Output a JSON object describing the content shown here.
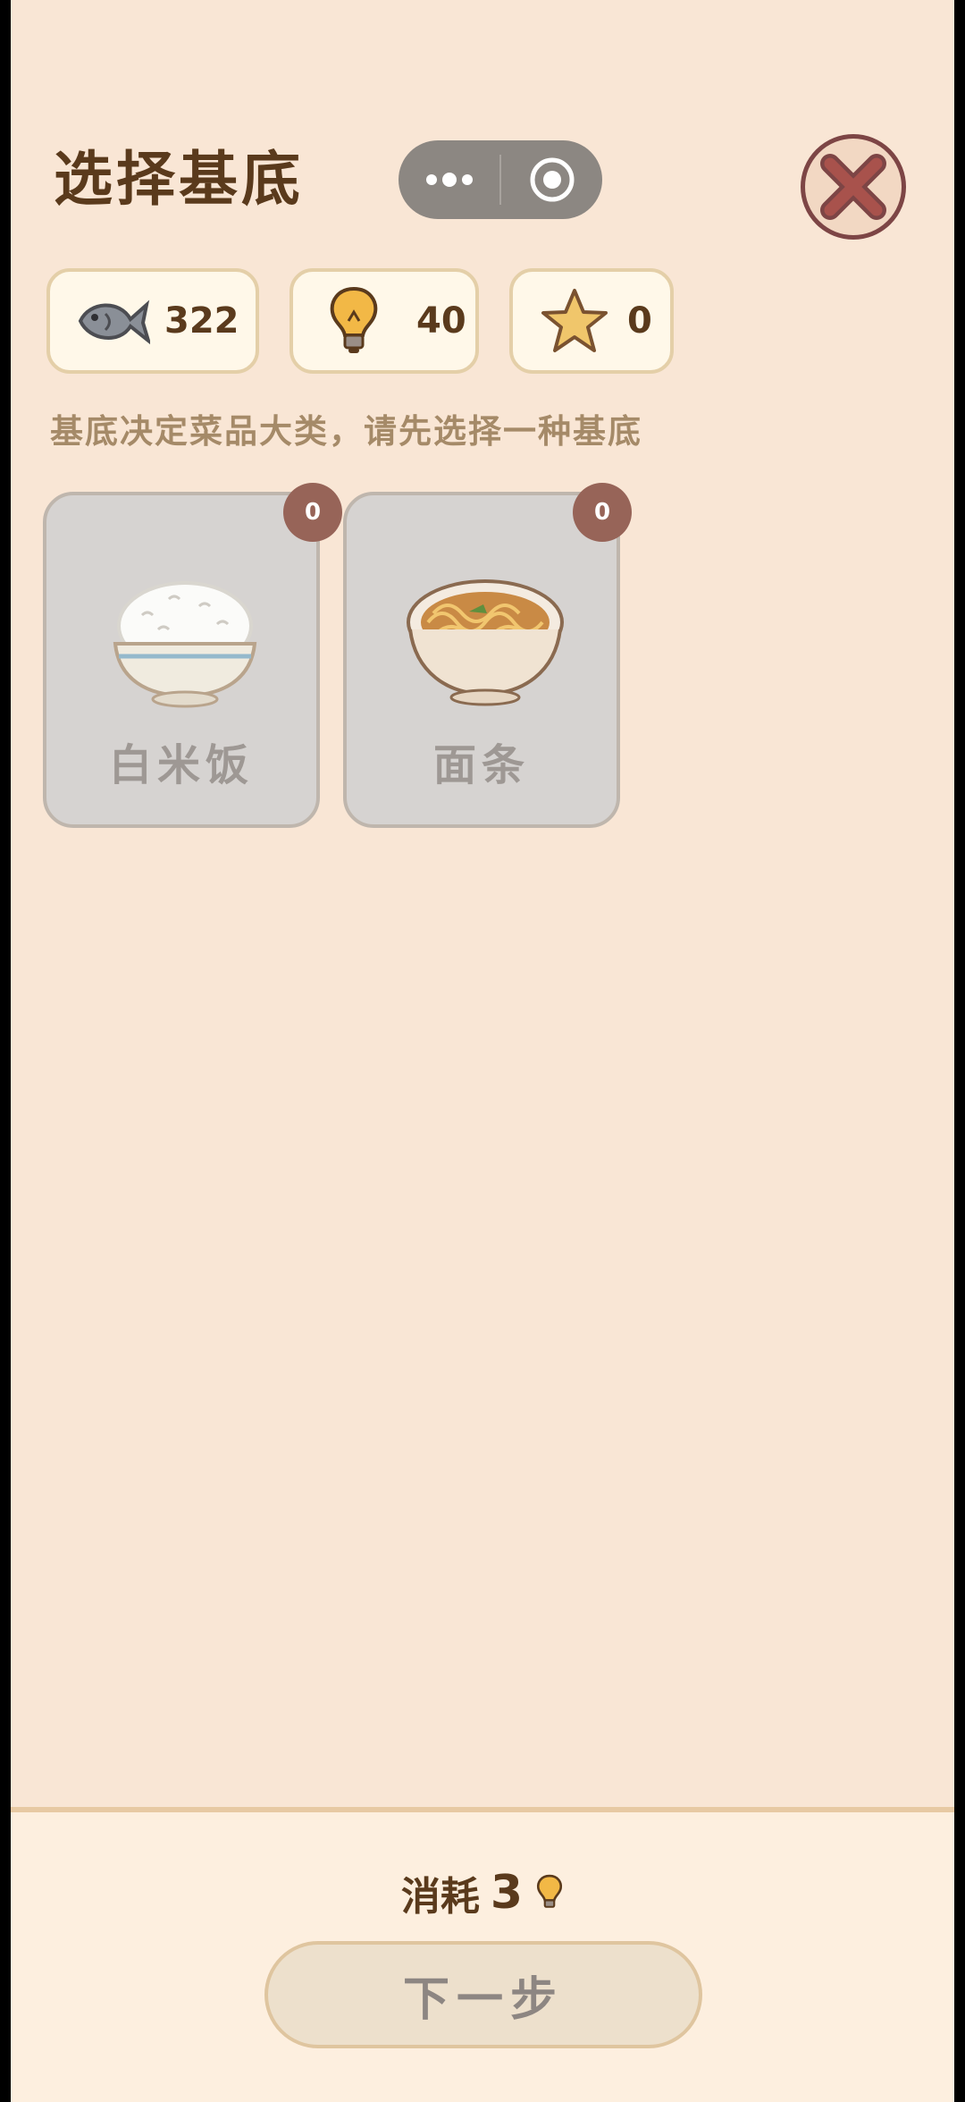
{
  "header": {
    "title": "选择基底"
  },
  "resources": [
    {
      "icon": "fish-icon",
      "value": "322"
    },
    {
      "icon": "lightbulb-icon",
      "value": "40"
    },
    {
      "icon": "star-icon",
      "value": "0"
    }
  ],
  "hint": "基底决定菜品大类，请先选择一种基底",
  "bases": [
    {
      "label": "白米饭",
      "count": "0",
      "icon": "rice-bowl-icon"
    },
    {
      "label": "面条",
      "count": "0",
      "icon": "noodle-bowl-icon"
    }
  ],
  "footer": {
    "cost_label": "消耗",
    "cost_value": "3",
    "cost_icon": "lightbulb-icon",
    "next_label": "下一步"
  },
  "colors": {
    "background": "#f9e6d5",
    "title": "#5a3a1c",
    "badge": "#976458",
    "card": "#d6d3d1"
  }
}
